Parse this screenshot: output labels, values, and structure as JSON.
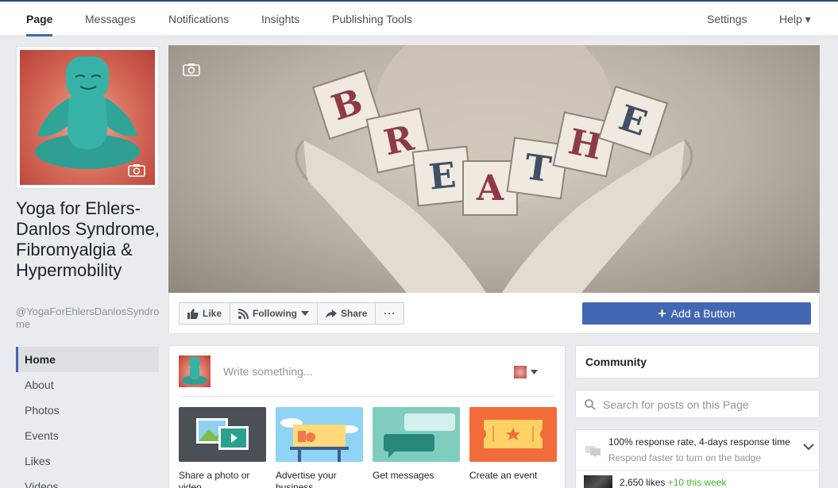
{
  "topnav": {
    "tabs": [
      "Page",
      "Messages",
      "Notifications",
      "Insights",
      "Publishing Tools"
    ],
    "settings": "Settings",
    "help": "Help ▾"
  },
  "page": {
    "name": "Yoga for Ehlers-Danlos Syndrome, Fibromyalgia & Hypermobility",
    "username": "@YogaForEhlersDanlosSyndrome"
  },
  "leftnav": {
    "items": [
      "Home",
      "About",
      "Photos",
      "Events",
      "Likes",
      "Videos"
    ]
  },
  "cover": {
    "letters": [
      "B",
      "R",
      "E",
      "A",
      "T",
      "H",
      "E"
    ]
  },
  "actions": {
    "like": "Like",
    "following": "Following",
    "share": "Share",
    "more": "···",
    "add_button": "Add a Button"
  },
  "composer": {
    "placeholder": "Write something...",
    "tiles": [
      {
        "label": "Share a photo or video"
      },
      {
        "label": "Advertise your business"
      },
      {
        "label": "Get messages"
      },
      {
        "label": "Create an event"
      }
    ]
  },
  "right": {
    "community": "Community",
    "search_placeholder": "Search for posts on this Page",
    "response_line1": "100% response rate, 4-days response time",
    "response_line2": "Respond faster to turn on the badge",
    "likes_count": "2,650 likes",
    "likes_week": "+10 this week"
  },
  "colors": {
    "accent": "#4267b2",
    "nav_border": "#2f477a",
    "background": "#e9ebee",
    "green": "#42b72a"
  }
}
